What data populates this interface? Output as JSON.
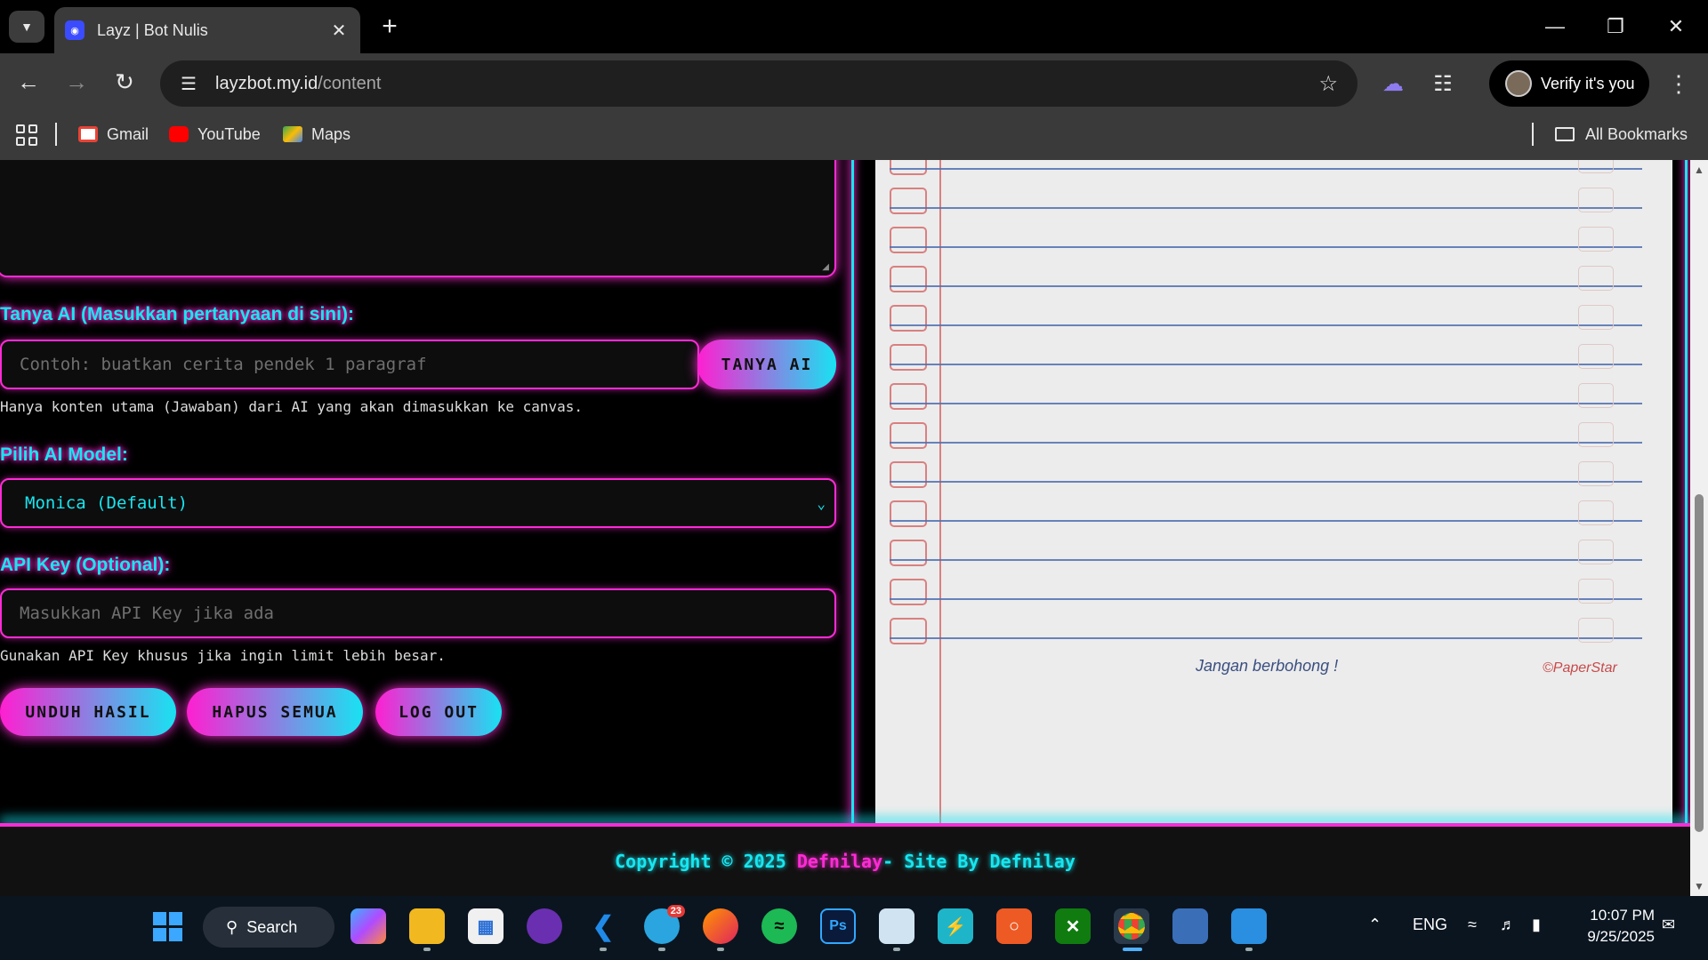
{
  "browser": {
    "tab_title": "Layz | Bot Nulis",
    "url_host": "layzbot.my.id",
    "url_path": "/content",
    "verify_label": "Verify it's you",
    "bookmarks": [
      "Gmail",
      "YouTube",
      "Maps"
    ],
    "all_bookmarks": "All Bookmarks"
  },
  "form": {
    "ask_label": "Tanya AI (Masukkan pertanyaan di sini):",
    "ask_placeholder": "Contoh: buatkan cerita pendek 1 paragraf",
    "ask_button": "TANYA AI",
    "ask_hint": "Hanya konten utama (Jawaban) dari AI yang akan dimasukkan ke canvas.",
    "model_label": "Pilih AI Model:",
    "model_value": "Monica (Default)",
    "api_label": "API Key (Optional):",
    "api_placeholder": "Masukkan API Key jika ada",
    "api_hint": "Gunakan API Key khusus jika ingin limit lebih besar.",
    "buttons": [
      "UNDUH HASIL",
      "HAPUS SEMUA",
      "LOG OUT"
    ]
  },
  "canvas": {
    "footer_text": "Jangan berbohong !",
    "brand_text": "©PaperStar"
  },
  "footer": {
    "prefix": "Copyright © 2025",
    "name": "Defnilay",
    "suffix": " - Site By Defnilay"
  },
  "taskbar": {
    "search_label": "Search",
    "lang": "ENG",
    "time": "10:07 PM",
    "date": "9/25/2025",
    "telegram_badge": "23"
  },
  "colors": {
    "neon_pink": "#ff2bd6",
    "neon_cyan": "#17e6f0"
  }
}
